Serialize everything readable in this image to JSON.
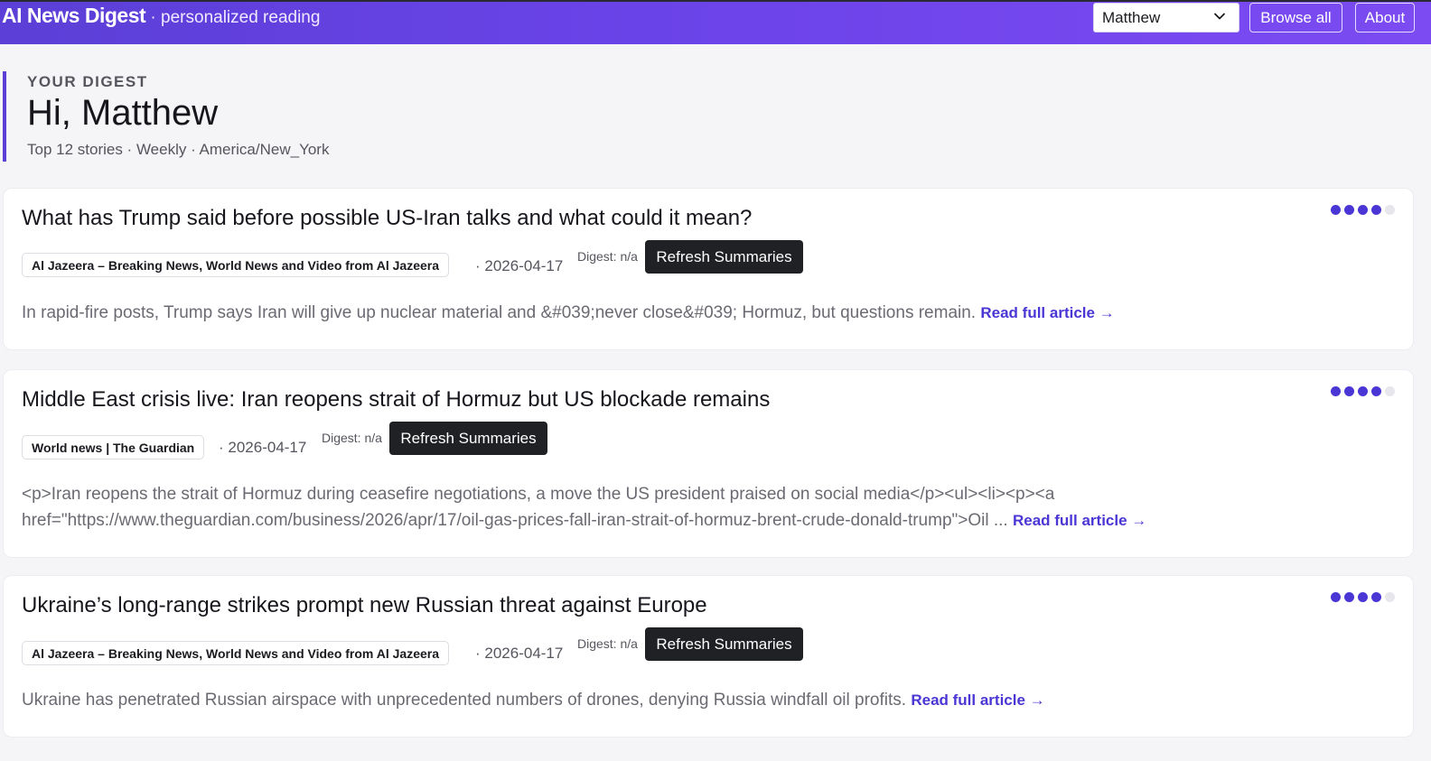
{
  "header": {
    "brand_name": "AI News Digest",
    "brand_tagline": " · personalized reading",
    "user_selected": "Matthew",
    "browse_label": "Browse all",
    "about_label": "About"
  },
  "digest": {
    "eyebrow": "YOUR DIGEST",
    "greeting": "Hi, Matthew",
    "meta": "Top 12 stories · Weekly · America/New_York"
  },
  "articles": [
    {
      "title": "What has Trump said before possible US-Iran talks and what could it mean?",
      "source": "Al Jazeera – Breaking News, World News and Video from Al Jazeera",
      "date": "· 2026-04-17",
      "digest_label": "Digest: n/a",
      "refresh_label": "Refresh Summaries",
      "summary": "In rapid-fire posts, Trump says Iran will give up nuclear material and &#039;never close&#039; Hormuz, but questions remain.",
      "read_label": "Read full article →",
      "relevance": 4,
      "relevance_max": 5
    },
    {
      "title": "Middle East crisis live: Iran reopens strait of Hormuz but US blockade remains",
      "source": "World news | The Guardian",
      "date": "· 2026-04-17",
      "digest_label": "Digest: n/a",
      "refresh_label": "Refresh Summaries",
      "summary_line1": "<p>Iran reopens the strait of Hormuz during ceasefire negotiations, a move the US president praised on social media</p><ul><li><p><a",
      "summary_line2": "href=\"https://www.theguardian.com/business/2026/apr/17/oil-gas-prices-fall-iran-strait-of-hormuz-brent-crude-donald-trump\">Oil ...",
      "read_label": "Read full article →",
      "relevance": 4,
      "relevance_max": 5
    },
    {
      "title": "Ukraine’s long-range strikes prompt new Russian threat against Europe",
      "source": "Al Jazeera – Breaking News, World News and Video from Al Jazeera",
      "date": "· 2026-04-17",
      "digest_label": "Digest: n/a",
      "refresh_label": "Refresh Summaries",
      "summary": "Ukraine has penetrated Russian airspace with unprecedented numbers of drones, denying Russia windfall oil profits.",
      "read_label": "Read full article →",
      "relevance": 4,
      "relevance_max": 5
    }
  ]
}
